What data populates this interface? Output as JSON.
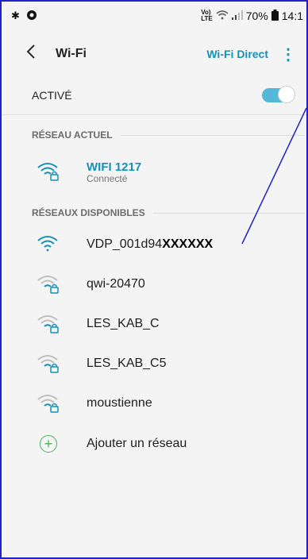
{
  "status_bar": {
    "notif_icon": "notification-icon",
    "app_icon": "app-icon",
    "volte": "Vo)\nLTE",
    "battery_pct": "70%",
    "time": "14:1"
  },
  "header": {
    "back_icon": "back-icon",
    "title": "Wi-Fi",
    "wifi_direct": "Wi-Fi Direct",
    "more_icon": "more-vert-icon"
  },
  "active": {
    "label": "ACTIVÉ",
    "enabled": true
  },
  "current_section": {
    "label": "RÉSEAU ACTUEL"
  },
  "current": {
    "ssid": "WIFI 1217",
    "status": "Connecté"
  },
  "available_section": {
    "label": "RÉSEAUX DISPONIBLES"
  },
  "networks": [
    {
      "ssid_prefix": "VDP_001d94",
      "ssid_strong": "XXXXXX",
      "secured": false,
      "strength": 4
    },
    {
      "ssid": "qwi-20470",
      "secured": true,
      "strength": 2
    },
    {
      "ssid": "LES_KAB_C",
      "secured": true,
      "strength": 2
    },
    {
      "ssid": "LES_KAB_C5",
      "secured": true,
      "strength": 2
    },
    {
      "ssid": "moustienne",
      "secured": true,
      "strength": 2
    }
  ],
  "add_network": {
    "label": "Ajouter un réseau"
  },
  "colors": {
    "accent": "#1790b5",
    "annotation": "#1e22c8",
    "add_green": "#4cb05a"
  }
}
